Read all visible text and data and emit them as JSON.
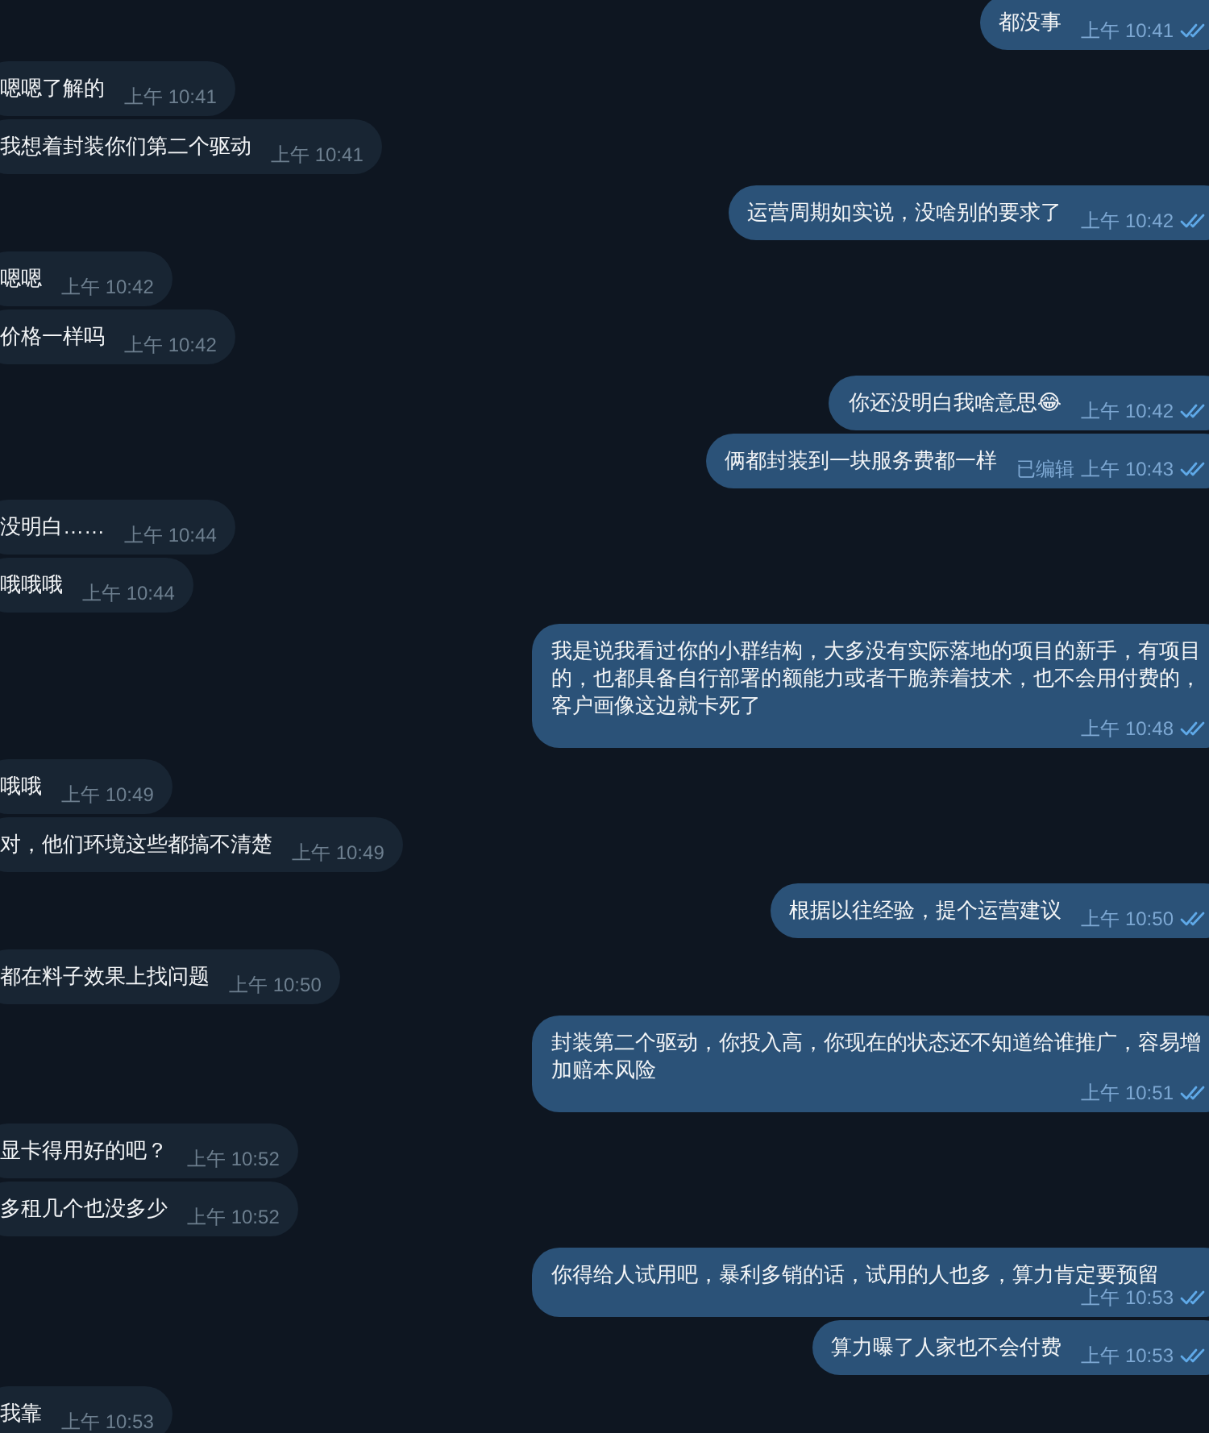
{
  "messages": [
    {
      "kind": "outgoing",
      "text": "都没事",
      "time": "上午 10:41",
      "read": true
    },
    {
      "kind": "incoming",
      "text": "嗯嗯了解的",
      "time": "上午 10:41"
    },
    {
      "kind": "incoming",
      "text": "我想着封装你们第二个驱动",
      "time": "上午 10:41"
    },
    {
      "kind": "outgoing",
      "text": "运营周期如实说，没啥别的要求了",
      "time": "上午 10:42",
      "read": true
    },
    {
      "kind": "incoming",
      "text": "嗯嗯",
      "time": "上午 10:42"
    },
    {
      "kind": "incoming",
      "text": "价格一样吗",
      "time": "上午 10:42"
    },
    {
      "kind": "outgoing",
      "text": "你还没明白我啥意思😂",
      "time": "上午 10:42",
      "read": true
    },
    {
      "kind": "outgoing",
      "text": "俩都封装到一块服务费都一样",
      "edited": "已编辑",
      "time": "上午 10:43",
      "read": true
    },
    {
      "kind": "incoming",
      "text": "没明白……",
      "time": "上午 10:44"
    },
    {
      "kind": "incoming",
      "text": "哦哦哦",
      "time": "上午 10:44"
    },
    {
      "kind": "outgoing",
      "text": "我是说我看过你的小群结构，大多没有实际落地的项目的新手，有项目的，也都具备自行部署的额能力或者干脆养着技术，也不会用付费的，客户画像这边就卡死了",
      "time": "上午 10:48",
      "read": true
    },
    {
      "kind": "incoming",
      "text": "哦哦",
      "time": "上午 10:49"
    },
    {
      "kind": "incoming",
      "text": "对，他们环境这些都搞不清楚",
      "time": "上午 10:49"
    },
    {
      "kind": "outgoing",
      "text": "根据以往经验，提个运营建议",
      "time": "上午 10:50",
      "read": true
    },
    {
      "kind": "incoming",
      "text": "都在料子效果上找问题",
      "time": "上午 10:50"
    },
    {
      "kind": "outgoing",
      "text": "封装第二个驱动，你投入高，你现在的状态还不知道给谁推广，容易增加赔本风险",
      "time": "上午 10:51",
      "read": true
    },
    {
      "kind": "incoming",
      "text": "显卡得用好的吧？",
      "time": "上午 10:52"
    },
    {
      "kind": "incoming",
      "text": "多租几个也没多少",
      "time": "上午 10:52"
    },
    {
      "kind": "outgoing",
      "text": "你得给人试用吧，暴利多销的话，试用的人也多，算力肯定要预留",
      "time": "上午 10:53",
      "read": true
    },
    {
      "kind": "outgoing",
      "text": "算力曝了人家也不会付费",
      "time": "上午 10:53",
      "read": true
    },
    {
      "kind": "incoming",
      "text": "我靠",
      "time": "上午 10:53"
    }
  ]
}
